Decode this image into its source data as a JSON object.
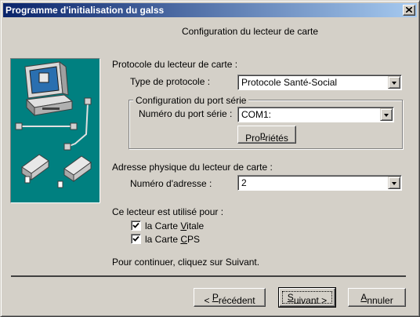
{
  "window": {
    "title": "Programme d'initialisation du galss"
  },
  "header": {
    "text": "Configuration du lecteur de carte"
  },
  "protocol_section": {
    "label": "Protocole du lecteur de carte :",
    "type_label": "Type de protocole :",
    "type_value": "Protocole Santé-Social"
  },
  "serial_group": {
    "label": "Configuration du port série",
    "port_label": "Numéro du port série :",
    "port_value": "COM1:",
    "properties_button": {
      "pre": "Pro",
      "accel": "p",
      "post": "riétés"
    }
  },
  "address_section": {
    "label": "Adresse physique du lecteur de carte :",
    "number_label": "Numéro d'adresse :",
    "number_value": "2"
  },
  "usage_section": {
    "label": "Ce lecteur est utilisé pour :",
    "vitale": {
      "pre": "la Carte ",
      "accel": "V",
      "post": "itale",
      "checked": true
    },
    "cps": {
      "pre": "la Carte ",
      "accel": "C",
      "post": "PS",
      "checked": true
    }
  },
  "footer_text": "Pour continuer, cliquez sur Suivant.",
  "buttons": {
    "previous": {
      "pre": "< ",
      "accel": "P",
      "post": "récédent"
    },
    "next": {
      "pre": "",
      "accel": "S",
      "post": "uivant >"
    },
    "cancel": {
      "pre": "",
      "accel": "A",
      "post": "nnuler"
    }
  }
}
